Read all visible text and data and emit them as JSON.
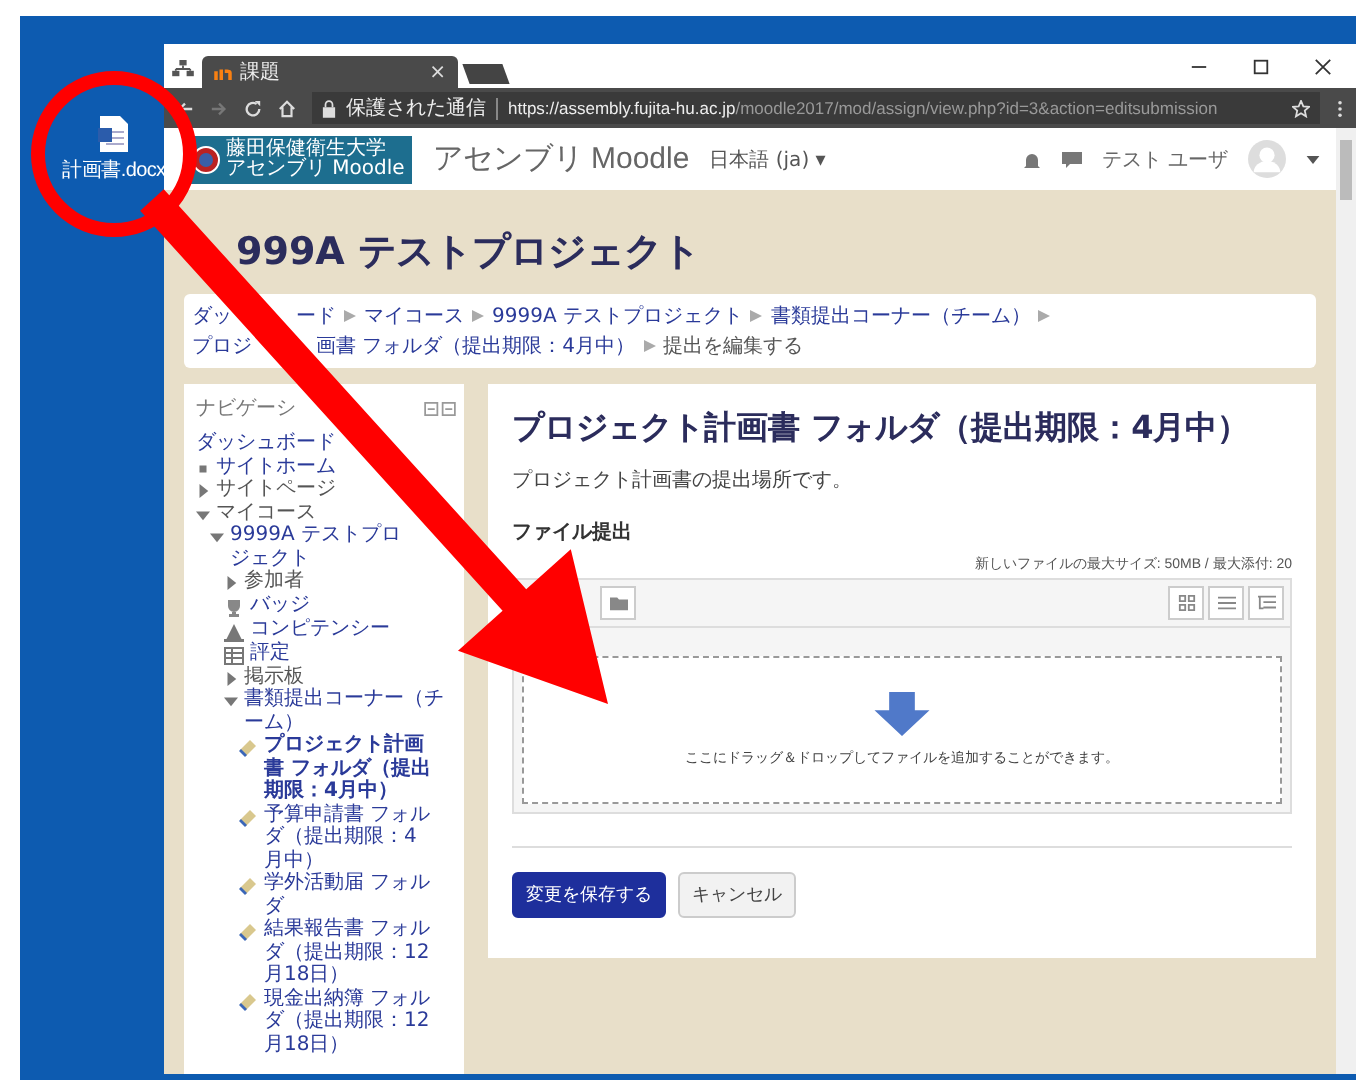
{
  "desktop": {
    "file_icon": {
      "label": "計画書.docx"
    }
  },
  "browser": {
    "tab": {
      "title": "課題",
      "close": "×"
    },
    "security": "保護された通信",
    "url_host": "https://assembly.fujita-hu.ac.jp",
    "url_path": "/moodle2017/mod/assign/view.php?id=3&action=editsubmission"
  },
  "header": {
    "logo_lines": [
      "藤田保健衛生大学",
      "アセンブリ Moodle"
    ],
    "site_name": "アセンブリ Moodle",
    "language": "日本語 (ja) ▾",
    "user_name": "テスト ユーザ"
  },
  "page_title": "999A テストプロジェクト",
  "breadcrumb": [
    {
      "parts": [
        "ダッ",
        "ード"
      ],
      "link": true
    },
    {
      "parts": [
        "マイコース"
      ],
      "link": true
    },
    {
      "parts": [
        "9999A テストプロジェクト"
      ],
      "link": true
    },
    {
      "parts": [
        "書類提出コーナー（チーム）"
      ],
      "link": true
    },
    {
      "parts": [
        "プロジ",
        "画書 フォルダ（提出期限：4月中）"
      ],
      "link": true
    },
    {
      "parts": [
        "提出を編集する"
      ],
      "link": false
    }
  ],
  "nav": {
    "title": "ナビゲーシ",
    "items": [
      {
        "kind": "link",
        "label": "ダッシュボード"
      },
      {
        "kind": "leaf",
        "label": "サイトホーム"
      },
      {
        "kind": "branch",
        "label": "サイトページ",
        "expanded": false
      },
      {
        "kind": "branch",
        "label": "マイコース",
        "expanded": true,
        "children": [
          {
            "kind": "branch",
            "label": "9999A テストプロジェクト",
            "expanded": true,
            "children": [
              {
                "kind": "branch",
                "label": "参加者",
                "expanded": false
              },
              {
                "kind": "badge",
                "label": "バッジ"
              },
              {
                "kind": "competency",
                "label": "コンピテンシー"
              },
              {
                "kind": "grades",
                "label": "評定"
              },
              {
                "kind": "branch",
                "label": "掲示板",
                "expanded": false
              },
              {
                "kind": "branch",
                "label": "書類提出コーナー（チーム）",
                "expanded": true,
                "children": [
                  {
                    "kind": "assign",
                    "label": "プロジェクト計画書 フォルダ（提出期限：4月中）",
                    "selected": true
                  },
                  {
                    "kind": "assign",
                    "label": "予算申請書 フォルダ（提出期限：4月中）",
                    "selected": false
                  },
                  {
                    "kind": "assign",
                    "label": "学外活動届 フォルダ",
                    "selected": false
                  },
                  {
                    "kind": "assign",
                    "label": "結果報告書 フォルダ（提出期限：12月18日）",
                    "selected": false
                  },
                  {
                    "kind": "assign",
                    "label": "現金出納簿 フォルダ（提出期限：12月18日）",
                    "selected": false
                  }
                ]
              }
            ]
          }
        ]
      }
    ]
  },
  "main": {
    "heading": "プロジェクト計画書 フォルダ（提出期限：4月中）",
    "description": "プロジェクト計画書の提出場所です。",
    "section_label": "ファイル提出",
    "limits": "新しいファイルの最大サイズ: 50MB / 最大添付: 20",
    "dropzone_text": "ここにドラッグ＆ドロップしてファイルを追加することができます。",
    "buttons": [
      {
        "kind": "primary",
        "label": "変更を保存する"
      },
      {
        "kind": "secondary",
        "label": "キャンセル"
      }
    ]
  }
}
